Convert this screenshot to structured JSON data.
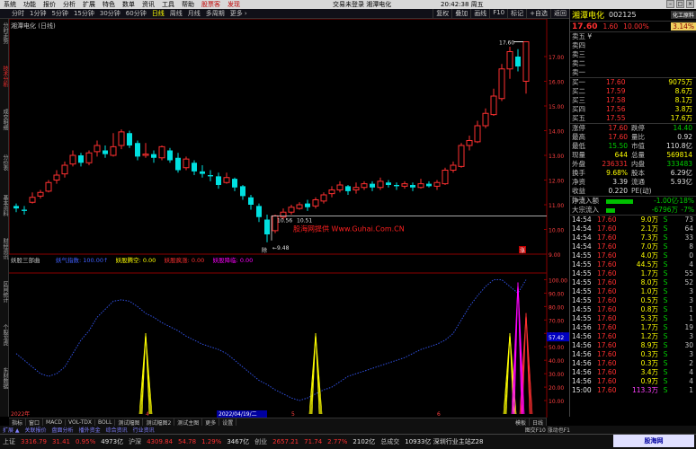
{
  "menu": {
    "items": [
      "系统",
      "功能",
      "报价",
      "分析",
      "扩展",
      "特色",
      "数单",
      "资讯",
      "工具",
      "帮助",
      "股票客",
      "发现"
    ],
    "center_title": "交易未登录  湘潭电化",
    "time": "20:42:38 周五"
  },
  "toolbar": {
    "items": [
      "分时",
      "1分钟",
      "5分钟",
      "15分钟",
      "30分钟",
      "60分钟",
      "日线",
      "周线",
      "月线",
      "多周期",
      "更多 ›"
    ],
    "active": "日线",
    "right_items": [
      "复权",
      "叠加",
      "画线",
      "F10",
      "标记",
      "+自选",
      "返回"
    ]
  },
  "left_tabs": [
    "分时走势",
    "技术分析",
    "成交明细",
    "分价表",
    "基本资料",
    "财经资讯",
    "区间统计",
    "个股龙虎",
    "东财数据"
  ],
  "chart": {
    "stock_label": "湘潭电化 (日线)",
    "price_high_label": "17.60",
    "price_low_label": "9.48",
    "annot_left": "10.56",
    "annot_right": "10.51",
    "watermark": "股海网提供 Www.Guhai.Com.CN",
    "indicator_name": "妖股三部曲",
    "indicator_legend": [
      {
        "label": "妖气指数: 100.00↑",
        "color": "#4060ff"
      },
      {
        "label": "妖股腾空: 0.00",
        "color": "#ffff00"
      },
      {
        "label": "妖股疯涨: 0.00",
        "color": "#ff3030"
      },
      {
        "label": "妖股降临: 0.00",
        "color": "#ff00ff"
      }
    ],
    "cursor_value": "57.42",
    "date_axis": [
      "2022年",
      "4",
      "2022/04/19/二",
      "5",
      "6"
    ],
    "price_axis": [
      "17.00",
      "16.00",
      "15.00",
      "14.00",
      "13.00",
      "12.00",
      "11.00",
      "10.00",
      "9.00"
    ],
    "ind_axis": [
      "100.00",
      "90.00",
      "80.00",
      "70.00",
      "60.00",
      "50.00",
      "40.00",
      "30.00",
      "20.00",
      "10.00"
    ],
    "mark_dan": "除",
    "mark_jiang": "涨"
  },
  "panel": {
    "name": "湘潭电化",
    "code": "002125",
    "tag": "化工原料",
    "price": "17.60",
    "change": "1.60",
    "pct": "10.00%",
    "box": "3.14%",
    "asks": [
      {
        "label": "卖五 ¥",
        "price": "",
        "qty": ""
      },
      {
        "label": "卖四",
        "price": "",
        "qty": ""
      },
      {
        "label": "卖三",
        "price": "",
        "qty": ""
      },
      {
        "label": "卖二",
        "price": "",
        "qty": ""
      },
      {
        "label": "卖一",
        "price": "",
        "qty": ""
      }
    ],
    "bids": [
      {
        "label": "买一",
        "price": "17.60",
        "qty": "9075万"
      },
      {
        "label": "买二",
        "price": "17.59",
        "qty": "8.6万"
      },
      {
        "label": "买三",
        "price": "17.58",
        "qty": "8.1万"
      },
      {
        "label": "买四",
        "price": "17.56",
        "qty": "3.8万"
      },
      {
        "label": "买五",
        "price": "17.55",
        "qty": "17.6万"
      }
    ],
    "stats": [
      {
        "a": "涨停",
        "b": "17.60",
        "bc": "red",
        "c": "跌停",
        "d": "14.40",
        "dc": "grn"
      },
      {
        "a": "最高",
        "b": "17.60",
        "bc": "red",
        "c": "量比",
        "d": "0.92",
        "dc": "wht"
      },
      {
        "a": "最低",
        "b": "15.50",
        "bc": "grn",
        "c": "市值",
        "d": "110.8亿",
        "dc": "wht"
      },
      {
        "a": "现量",
        "b": "644",
        "bc": "yel",
        "c": "总量",
        "d": "569814",
        "dc": "yel"
      },
      {
        "a": "外盘",
        "b": "236331",
        "bc": "red",
        "c": "内盘",
        "d": "333483",
        "dc": "grn"
      },
      {
        "a": "换手",
        "b": "9.68%",
        "bc": "yel",
        "c": "股本",
        "d": "6.29亿",
        "dc": "wht"
      },
      {
        "a": "净资",
        "b": "3.39",
        "bc": "wht",
        "c": "流通",
        "d": "5.93亿",
        "dc": "wht"
      },
      {
        "a": "收益(一)",
        "b": "0.220",
        "bc": "wht",
        "c": "PE(动)",
        "d": "",
        "dc": "wht"
      }
    ],
    "flows": [
      {
        "label": "净流入额",
        "value": "-1.00亿",
        "pct": "-18%"
      },
      {
        "label": "大宗流入",
        "value": "-6796万",
        "pct": "-7%"
      }
    ],
    "ticks": [
      {
        "t": "14:54",
        "p": "17.60",
        "v": "9.0万",
        "vc": "yel",
        "s": "S",
        "sc": "grn",
        "n": "73"
      },
      {
        "t": "14:54",
        "p": "17.60",
        "v": "2.1万",
        "vc": "yel",
        "s": "S",
        "sc": "grn",
        "n": "64"
      },
      {
        "t": "14:54",
        "p": "17.60",
        "v": "7.3万",
        "vc": "yel",
        "s": "S",
        "sc": "grn",
        "n": "33"
      },
      {
        "t": "14:54",
        "p": "17.60",
        "v": "7.0万",
        "vc": "yel",
        "s": "S",
        "sc": "grn",
        "n": "8"
      },
      {
        "t": "14:55",
        "p": "17.60",
        "v": "4.0万",
        "vc": "yel",
        "s": "S",
        "sc": "grn",
        "n": "0"
      },
      {
        "t": "14:55",
        "p": "17.60",
        "v": "44.5万",
        "vc": "yel",
        "s": "S",
        "sc": "grn",
        "n": "4"
      },
      {
        "t": "14:55",
        "p": "17.60",
        "v": "1.7万",
        "vc": "yel",
        "s": "S",
        "sc": "grn",
        "n": "55"
      },
      {
        "t": "14:55",
        "p": "17.60",
        "v": "8.0万",
        "vc": "yel",
        "s": "S",
        "sc": "grn",
        "n": "52"
      },
      {
        "t": "14:55",
        "p": "17.60",
        "v": "1.0万",
        "vc": "yel",
        "s": "S",
        "sc": "grn",
        "n": "3"
      },
      {
        "t": "14:55",
        "p": "17.60",
        "v": "0.5万",
        "vc": "yel",
        "s": "S",
        "sc": "grn",
        "n": "3"
      },
      {
        "t": "14:55",
        "p": "17.60",
        "v": "0.8万",
        "vc": "yel",
        "s": "S",
        "sc": "grn",
        "n": "1"
      },
      {
        "t": "14:55",
        "p": "17.60",
        "v": "5.3万",
        "vc": "yel",
        "s": "S",
        "sc": "grn",
        "n": "1"
      },
      {
        "t": "14:56",
        "p": "17.60",
        "v": "1.7万",
        "vc": "yel",
        "s": "S",
        "sc": "grn",
        "n": "19"
      },
      {
        "t": "14:56",
        "p": "17.60",
        "v": "1.2万",
        "vc": "yel",
        "s": "S",
        "sc": "grn",
        "n": "3"
      },
      {
        "t": "14:56",
        "p": "17.60",
        "v": "8.9万",
        "vc": "yel",
        "s": "S",
        "sc": "grn",
        "n": "30"
      },
      {
        "t": "14:56",
        "p": "17.60",
        "v": "0.3万",
        "vc": "yel",
        "s": "S",
        "sc": "grn",
        "n": "3"
      },
      {
        "t": "14:56",
        "p": "17.60",
        "v": "0.3万",
        "vc": "yel",
        "s": "S",
        "sc": "grn",
        "n": "2"
      },
      {
        "t": "14:56",
        "p": "17.60",
        "v": "3.4万",
        "vc": "yel",
        "s": "S",
        "sc": "grn",
        "n": "4"
      },
      {
        "t": "14:56",
        "p": "17.60",
        "v": "0.9万",
        "vc": "yel",
        "s": "S",
        "sc": "grn",
        "n": "4"
      },
      {
        "t": "15:00",
        "p": "17.60",
        "v": "113.3万",
        "vc": "mag",
        "s": "S",
        "sc": "grn",
        "n": "1"
      }
    ]
  },
  "bottom_tabs": [
    "指标",
    "窗口",
    "MACD",
    "VOL-TDX",
    "BOLL",
    "测试幅图",
    "测试幅图2",
    "测试主图",
    "更多",
    "设置"
  ],
  "bottom_tabs_right": [
    "模板",
    "日线"
  ],
  "bottom_tabs2": [
    "扩展 ▲",
    "关联报价",
    "盘面分析",
    "播外资金",
    "综合资讯",
    "行业资讯"
  ],
  "bottom_tabs2_right": "图交F10 涨动也F1",
  "status": [
    {
      "label": "上证",
      "color": "#c0c0c0"
    },
    {
      "label": "3316.79",
      "color": "#ff3030"
    },
    {
      "label": "31.41",
      "color": "#ff3030"
    },
    {
      "label": "0.95%",
      "color": "#ff3030"
    },
    {
      "label": "4973亿",
      "color": "#e0e0e0"
    },
    {
      "label": "沪深",
      "color": "#c0c0c0"
    },
    {
      "label": "4309.84",
      "color": "#ff3030"
    },
    {
      "label": "54.78",
      "color": "#ff3030"
    },
    {
      "label": "1.29%",
      "color": "#ff3030"
    },
    {
      "label": "3467亿",
      "color": "#e0e0e0"
    },
    {
      "label": "创业",
      "color": "#c0c0c0"
    },
    {
      "label": "2657.21",
      "color": "#ff3030"
    },
    {
      "label": "71.74",
      "color": "#ff3030"
    },
    {
      "label": "2.77%",
      "color": "#ff3030"
    },
    {
      "label": "2102亿",
      "color": "#e0e0e0"
    },
    {
      "label": "总成交",
      "color": "#c0c0c0"
    },
    {
      "label": "10933亿 深圳行业主站Z28",
      "color": "#e0e0e0"
    }
  ],
  "logo": "股海网 Www.Guhai.Com.CN",
  "colors": {
    "up": "#ff3030",
    "down": "#00e0e0",
    "indicator_line": "#3050e0",
    "yellow": "#ffff00",
    "red": "#ff3030",
    "magenta": "#ff00ff"
  },
  "chart_data": {
    "type": "candlestick",
    "candles": [
      [
        10.95,
        10.85,
        11.05,
        10.7
      ],
      [
        10.8,
        10.75,
        10.95,
        10.6
      ],
      [
        11.1,
        11.3,
        11.5,
        11.05
      ],
      [
        11.35,
        11.5,
        11.6,
        11.25
      ],
      [
        11.55,
        11.9,
        12.0,
        11.5
      ],
      [
        12.0,
        12.2,
        12.4,
        11.85
      ],
      [
        12.25,
        12.6,
        12.75,
        12.1
      ],
      [
        12.65,
        13.0,
        13.2,
        12.55
      ],
      [
        13.0,
        12.7,
        13.1,
        12.55
      ],
      [
        12.7,
        13.1,
        13.2,
        12.6
      ],
      [
        13.15,
        13.4,
        13.6,
        12.95
      ],
      [
        13.2,
        13.05,
        13.4,
        12.9
      ],
      [
        13.0,
        13.35,
        13.9,
        12.95
      ],
      [
        13.4,
        13.95,
        14.05,
        13.25
      ],
      [
        13.9,
        13.4,
        14.0,
        13.3
      ],
      [
        13.5,
        12.95,
        13.6,
        12.8
      ],
      [
        13.0,
        13.05,
        13.5,
        12.9
      ],
      [
        13.05,
        12.9,
        13.2,
        12.7
      ],
      [
        12.9,
        13.35,
        13.4,
        12.8
      ],
      [
        13.2,
        12.8,
        13.3,
        12.7
      ],
      [
        12.9,
        12.4,
        13.1,
        12.3
      ],
      [
        12.5,
        12.85,
        12.95,
        12.4
      ],
      [
        12.7,
        12.35,
        12.8,
        12.2
      ],
      [
        12.35,
        12.25,
        12.6,
        12.1
      ],
      [
        12.2,
        12.15,
        12.4,
        11.95
      ],
      [
        12.15,
        11.8,
        12.3,
        11.65
      ],
      [
        11.9,
        12.1,
        12.3,
        11.85
      ],
      [
        12.05,
        11.7,
        12.1,
        11.55
      ],
      [
        11.75,
        11.35,
        11.8,
        11.2
      ],
      [
        11.3,
        11.0,
        11.4,
        10.8
      ],
      [
        10.95,
        10.5,
        11.05,
        10.3
      ],
      [
        10.4,
        9.8,
        10.6,
        9.48
      ],
      [
        9.95,
        10.55,
        10.6,
        9.85
      ],
      [
        10.5,
        10.7,
        10.85,
        10.4
      ],
      [
        10.7,
        10.9,
        11.0,
        10.6
      ],
      [
        10.85,
        11.0,
        11.1,
        10.8
      ],
      [
        11.05,
        10.9,
        11.2,
        10.75
      ],
      [
        10.95,
        11.2,
        11.3,
        10.85
      ],
      [
        11.15,
        11.4,
        11.5,
        11.05
      ],
      [
        11.45,
        11.6,
        11.75,
        11.3
      ],
      [
        11.6,
        11.8,
        11.95,
        11.5
      ],
      [
        11.75,
        11.55,
        11.8,
        11.4
      ],
      [
        11.6,
        11.7,
        11.9,
        11.45
      ],
      [
        11.7,
        11.85,
        11.95,
        11.6
      ],
      [
        11.85,
        11.7,
        11.95,
        11.55
      ],
      [
        11.7,
        11.95,
        12.1,
        11.6
      ],
      [
        11.9,
        11.8,
        12.0,
        11.7
      ],
      [
        11.8,
        11.75,
        11.9,
        11.6
      ],
      [
        11.75,
        11.85,
        11.95,
        11.65
      ],
      [
        11.8,
        11.7,
        11.9,
        11.55
      ],
      [
        11.7,
        11.85,
        12.05,
        11.65
      ],
      [
        11.85,
        11.75,
        11.95,
        11.7
      ],
      [
        11.75,
        11.9,
        12.0,
        11.6
      ],
      [
        11.85,
        12.4,
        12.5,
        11.8
      ],
      [
        12.4,
        12.6,
        12.75,
        12.3
      ],
      [
        12.55,
        13.4,
        13.5,
        12.5
      ],
      [
        13.4,
        13.6,
        13.8,
        13.2
      ],
      [
        13.55,
        14.2,
        14.4,
        13.5
      ],
      [
        14.2,
        14.7,
        14.9,
        14.1
      ],
      [
        14.65,
        15.4,
        15.7,
        14.6
      ],
      [
        15.3,
        16.5,
        16.7,
        15.2
      ],
      [
        16.5,
        17.2,
        17.4,
        16.1
      ],
      [
        17.0,
        16.6,
        17.3,
        16.4
      ],
      [
        16.0,
        17.6,
        17.6,
        15.5
      ]
    ],
    "ylim": [
      9.0,
      17.8
    ],
    "indicator": {
      "name": "妖股三部曲",
      "series": [
        {
          "name": "妖气指数",
          "values": [
            45,
            40,
            35,
            30,
            28,
            30,
            35,
            45,
            55,
            62,
            72,
            78,
            84,
            85,
            84,
            80,
            75,
            72,
            68,
            65,
            62,
            58,
            55,
            52,
            50,
            48,
            45,
            40,
            35,
            30,
            25,
            22,
            18,
            15,
            12,
            10,
            12,
            15,
            18,
            20,
            24,
            28,
            30,
            32,
            34,
            36,
            38,
            40,
            42,
            45,
            48,
            50,
            52,
            55,
            60,
            70,
            80,
            88,
            95,
            100,
            100,
            95,
            90,
            100
          ]
        },
        {
          "name": "妖股腾空",
          "points": [
            [
              16,
              60
            ],
            [
              37,
              60
            ],
            [
              61,
              60
            ]
          ]
        },
        {
          "name": "妖股疯涨",
          "points": [
            [
              63,
              75
            ]
          ]
        },
        {
          "name": "妖股降临",
          "points": [
            [
              62,
              98
            ]
          ]
        }
      ],
      "ylim": [
        0,
        105
      ]
    }
  }
}
